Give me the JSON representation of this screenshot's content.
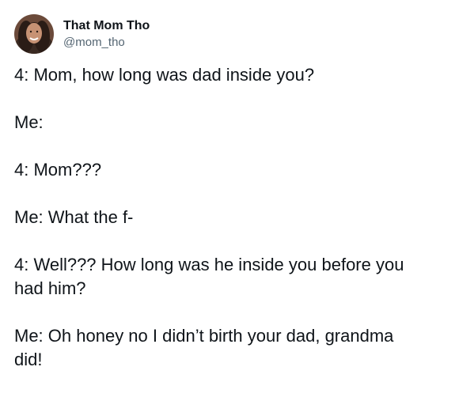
{
  "author": {
    "display_name": "That Mom Tho",
    "handle": "@mom_tho",
    "avatar_icon": "profile-photo-avatar"
  },
  "tweet": {
    "lines": [
      "4: Mom, how long was dad inside you?",
      "Me:",
      "4: Mom???",
      "Me: What the f-",
      "4: Well??? How long was he inside you before you",
      "had him?",
      "Me: Oh honey no I didn’t birth your dad, grandma",
      "did!"
    ]
  },
  "colors": {
    "text": "#0f1419",
    "secondary": "#536471",
    "background": "#ffffff"
  }
}
